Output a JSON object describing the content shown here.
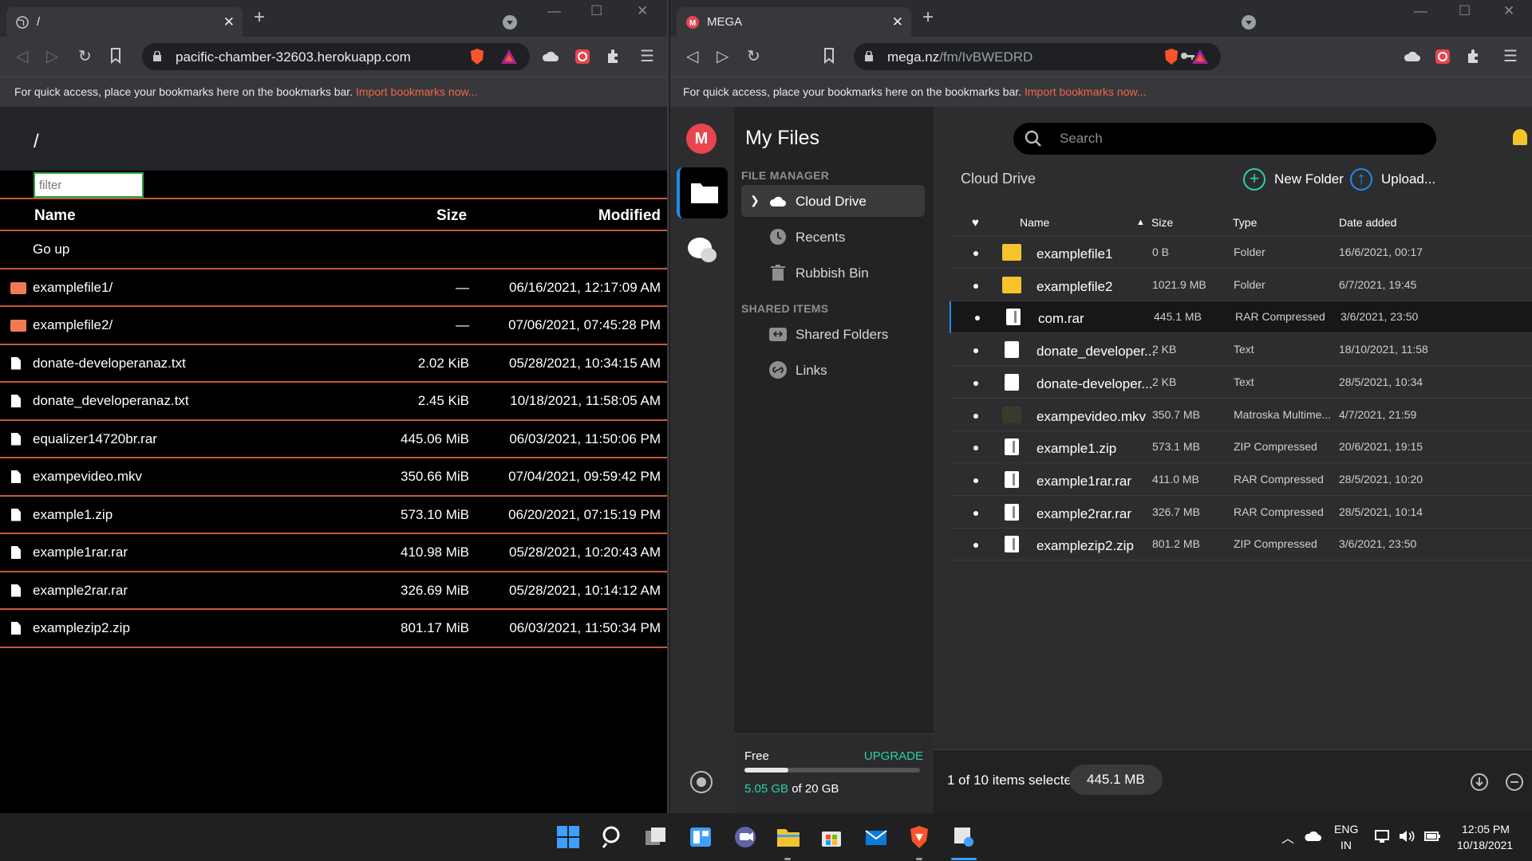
{
  "left_browser": {
    "tab_title": "/",
    "address_host": "pacific-chamber-32603.herokuapp.com",
    "bookmarks_text": "For quick access, place your bookmarks here on the bookmarks bar.",
    "bookmarks_link": "Import bookmarks now...",
    "page": {
      "path": "/",
      "filter_placeholder": "filter",
      "columns": {
        "name": "Name",
        "size": "Size",
        "modified": "Modified"
      },
      "go_up": "Go up",
      "rows": [
        {
          "name": "examplefile1/",
          "size": "—",
          "modified": "06/16/2021, 12:17:09 AM",
          "kind": "folder"
        },
        {
          "name": "examplefile2/",
          "size": "—",
          "modified": "07/06/2021, 07:45:28 PM",
          "kind": "folder"
        },
        {
          "name": "donate-developeranaz.txt",
          "size": "2.02 KiB",
          "modified": "05/28/2021, 10:34:15 AM",
          "kind": "file"
        },
        {
          "name": "donate_developeranaz.txt",
          "size": "2.45 KiB",
          "modified": "10/18/2021, 11:58:05 AM",
          "kind": "file"
        },
        {
          "name": "equalizer14720br.rar",
          "size": "445.06 MiB",
          "modified": "06/03/2021, 11:50:06 PM",
          "kind": "file"
        },
        {
          "name": "exampevideo.mkv",
          "size": "350.66 MiB",
          "modified": "07/04/2021, 09:59:42 PM",
          "kind": "file"
        },
        {
          "name": "example1.zip",
          "size": "573.10 MiB",
          "modified": "06/20/2021, 07:15:19 PM",
          "kind": "file"
        },
        {
          "name": "example1rar.rar",
          "size": "410.98 MiB",
          "modified": "05/28/2021, 10:20:43 AM",
          "kind": "file"
        },
        {
          "name": "example2rar.rar",
          "size": "326.69 MiB",
          "modified": "05/28/2021, 10:14:12 AM",
          "kind": "file"
        },
        {
          "name": "examplezip2.zip",
          "size": "801.17 MiB",
          "modified": "06/03/2021, 11:50:34 PM",
          "kind": "file"
        }
      ]
    }
  },
  "right_browser": {
    "tab_title": "MEGA",
    "address_host": "mega.nz",
    "address_path": "/fm/IvBWEDRD",
    "bookmarks_text": "For quick access, place your bookmarks here on the bookmarks bar.",
    "bookmarks_link": "Import bookmarks now...",
    "mega": {
      "logo_letter": "M",
      "sidebar_title": "My Files",
      "file_manager_label": "FILE MANAGER",
      "nav": {
        "cloud_drive": "Cloud Drive",
        "recents": "Recents",
        "rubbish_bin": "Rubbish Bin"
      },
      "shared_items_label": "SHARED ITEMS",
      "shared": {
        "shared_folders": "Shared Folders",
        "links": "Links"
      },
      "quota": {
        "plan": "Free",
        "upgrade": "UPGRADE",
        "used": "5.05 GB",
        "of_total": "of 20 GB",
        "used_fraction": 0.25
      },
      "search_placeholder": "Search",
      "breadcrumb": "Cloud Drive",
      "new_folder": "New Folder",
      "upload": "Upload...",
      "columns": {
        "name": "Name",
        "size": "Size",
        "type": "Type",
        "date_added": "Date added"
      },
      "rows": [
        {
          "name": "examplefile1",
          "size": "0 B",
          "type": "Folder",
          "date": "16/6/2021, 00:17",
          "icon": "folder"
        },
        {
          "name": "examplefile2",
          "size": "1021.9 MB",
          "type": "Folder",
          "date": "6/7/2021, 19:45",
          "icon": "folder"
        },
        {
          "name": "com.rar",
          "size": "445.1 MB",
          "type": "RAR Compressed",
          "date": "3/6/2021, 23:50",
          "icon": "archive",
          "selected": true
        },
        {
          "name": "donate_developer...",
          "size": "2 KB",
          "type": "Text",
          "date": "18/10/2021, 11:58",
          "icon": "text"
        },
        {
          "name": "donate-developer...",
          "size": "2 KB",
          "type": "Text",
          "date": "28/5/2021, 10:34",
          "icon": "text"
        },
        {
          "name": "exampevideo.mkv",
          "size": "350.7 MB",
          "type": "Matroska Multime...",
          "date": "4/7/2021, 21:59",
          "icon": "video"
        },
        {
          "name": "example1.zip",
          "size": "573.1 MB",
          "type": "ZIP Compressed",
          "date": "20/6/2021, 19:15",
          "icon": "archive"
        },
        {
          "name": "example1rar.rar",
          "size": "411.0 MB",
          "type": "RAR Compressed",
          "date": "28/5/2021, 10:20",
          "icon": "archive"
        },
        {
          "name": "example2rar.rar",
          "size": "326.7 MB",
          "type": "RAR Compressed",
          "date": "28/5/2021, 10:14",
          "icon": "archive"
        },
        {
          "name": "examplezip2.zip",
          "size": "801.2 MB",
          "type": "ZIP Compressed",
          "date": "3/6/2021, 23:50",
          "icon": "archive"
        }
      ],
      "footer": {
        "selection": "1 of 10 items selected",
        "selection_size": "445.1 MB"
      }
    }
  },
  "taskbar": {
    "lang": "ENG",
    "region": "IN",
    "time": "12:05 PM",
    "date": "10/18/2021"
  },
  "colors": {
    "accent_orange": "#f07b52",
    "mega_red": "#e9454f",
    "mega_green": "#2ad0a8",
    "mega_blue": "#1d8cf0"
  }
}
